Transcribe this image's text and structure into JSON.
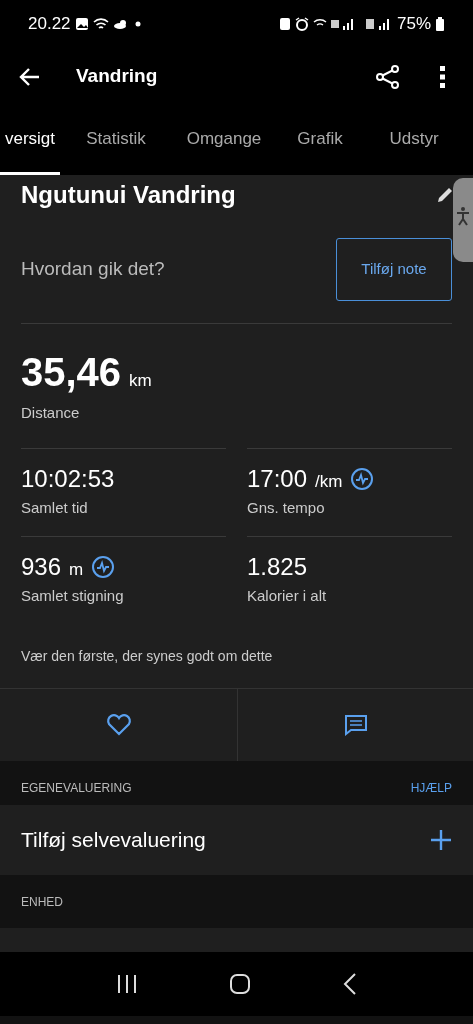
{
  "status_bar": {
    "time": "20.22",
    "battery": "75%"
  },
  "app_bar": {
    "title": "Vandring"
  },
  "tabs": [
    {
      "label": "versigt",
      "selected": true
    },
    {
      "label": "Statistik",
      "selected": false
    },
    {
      "label": "Omgange",
      "selected": false
    },
    {
      "label": "Grafik",
      "selected": false
    },
    {
      "label": "Udstyr",
      "selected": false
    }
  ],
  "activity": {
    "name": "Ngutunui Vandring",
    "prompt": "Hvordan gik det?",
    "note_button": "Tilføj note"
  },
  "headline": {
    "value": "35,46",
    "unit": "km",
    "label": "Distance"
  },
  "stats": [
    {
      "value": "10:02:53",
      "label": "Samlet tid",
      "chart_icon": false
    },
    {
      "value": "17:00",
      "unit": "/km",
      "label": "Gns. tempo",
      "chart_icon": true
    },
    {
      "value": "936",
      "unit": "m",
      "label": "Samlet stigning",
      "chart_icon": true
    },
    {
      "value": "1.825",
      "label": "Kalorier i alt",
      "chart_icon": false
    }
  ],
  "likes_text": "Vær den første, der synes godt om dette",
  "self_evaluation": {
    "header": "EGENEVALUERING",
    "help": "HJÆLP",
    "row": "Tilføj selvevaluering"
  },
  "device": {
    "header": "ENHED"
  }
}
